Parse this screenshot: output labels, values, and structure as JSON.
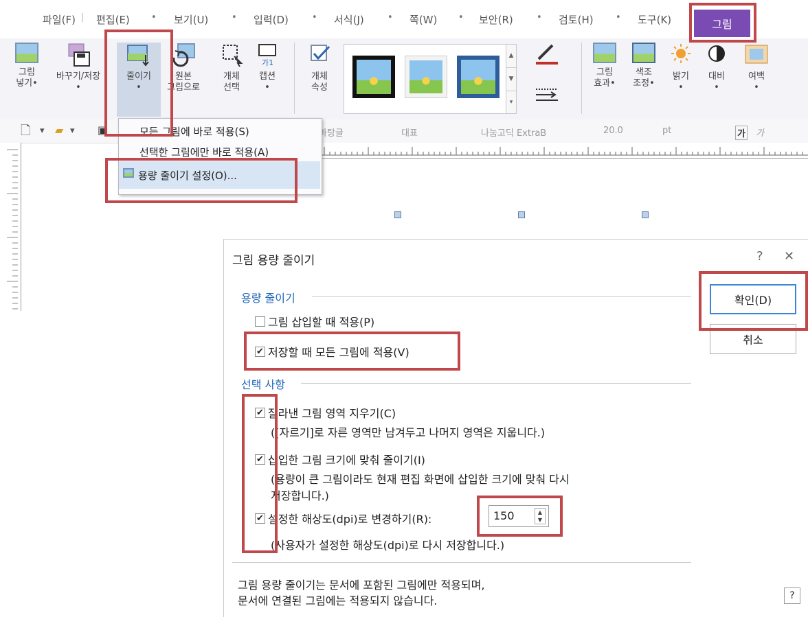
{
  "menubar": {
    "items": [
      "파일(F)",
      "편집(E)",
      "보기(U)",
      "입력(D)",
      "서식(J)",
      "쪽(W)",
      "보안(R)",
      "검토(H)",
      "도구(K)"
    ],
    "active_tab": "그림",
    "dot": "•"
  },
  "ribbon": {
    "buttons": [
      {
        "line1": "그림",
        "line2": "넣기•"
      },
      {
        "line1": "바꾸기/저장",
        "line2": "•"
      },
      {
        "line1": "줄이기",
        "line2": "•"
      },
      {
        "line1": "원본",
        "line2": "그림으로"
      },
      {
        "line1": "개체",
        "line2": "선택"
      },
      {
        "line1": "캡션",
        "line2": "•"
      },
      {
        "line1": "개체",
        "line2": "속성"
      },
      {
        "line1": "그림",
        "line2": "효과•"
      },
      {
        "line1": "색조",
        "line2": "조정•"
      },
      {
        "line1": "밝기",
        "line2": "•"
      },
      {
        "line1": "대비",
        "line2": "•"
      },
      {
        "line1": "여백",
        "line2": "•"
      }
    ],
    "caption_icon_text": "가1"
  },
  "toolbar2": {
    "style_name": "바탕글",
    "para_style": "대표",
    "font_name": "나눔고딕 ExtraB",
    "font_size": "20.0",
    "unit": "pt",
    "bold_glyph": "가",
    "italic_glyph": "가"
  },
  "dropdown": {
    "items": [
      "모든 그림에 바로 적용(S)",
      "선택한 그림에만 바로 적용(A)",
      "용량 줄이기 설정(O)..."
    ]
  },
  "dialog": {
    "title": "그림 용량 줄이기",
    "help_glyph": "?",
    "close_glyph": "✕",
    "section1": "용량 줄이기",
    "opt_insert": "그림 삽입할 때 적용(P)",
    "opt_save": "저장할 때 모든 그림에 적용(V)",
    "section2": "선택 사항",
    "opt_crop": "잘라낸 그림 영역 지우기(C)",
    "opt_crop_desc": "([자르기]로 자른 영역만 남겨두고 나머지 영역은 지웁니다.)",
    "opt_fit": "삽입한 그림 크기에 맞춰 줄이기(I)",
    "opt_fit_desc1": "(용량이 큰 그림이라도 현재 편집 화면에 삽입한 크기에 맞춰 다시",
    "opt_fit_desc2": "저장합니다.)",
    "opt_dpi": "설정한 해상도(dpi)로 변경하기(R):",
    "dpi_value": "150",
    "opt_dpi_desc": "(사용자가 설정한 해상도(dpi)로 다시 저장합니다.)",
    "footer1": "그림 용량 줄이기는 문서에 포함된 그림에만 적용되며,",
    "footer2": "문서에 연결된 그림에는 적용되지 않습니다.",
    "ok": "확인(D)",
    "cancel": "취소",
    "check_glyph": "✔",
    "checked": {
      "insert": false,
      "save": true,
      "crop": true,
      "fit": true,
      "dpi": true
    }
  },
  "colors": {
    "accent_tab": "#7a4bb3",
    "highlight_box": "#c0484a",
    "section_text": "#1f66b8"
  }
}
